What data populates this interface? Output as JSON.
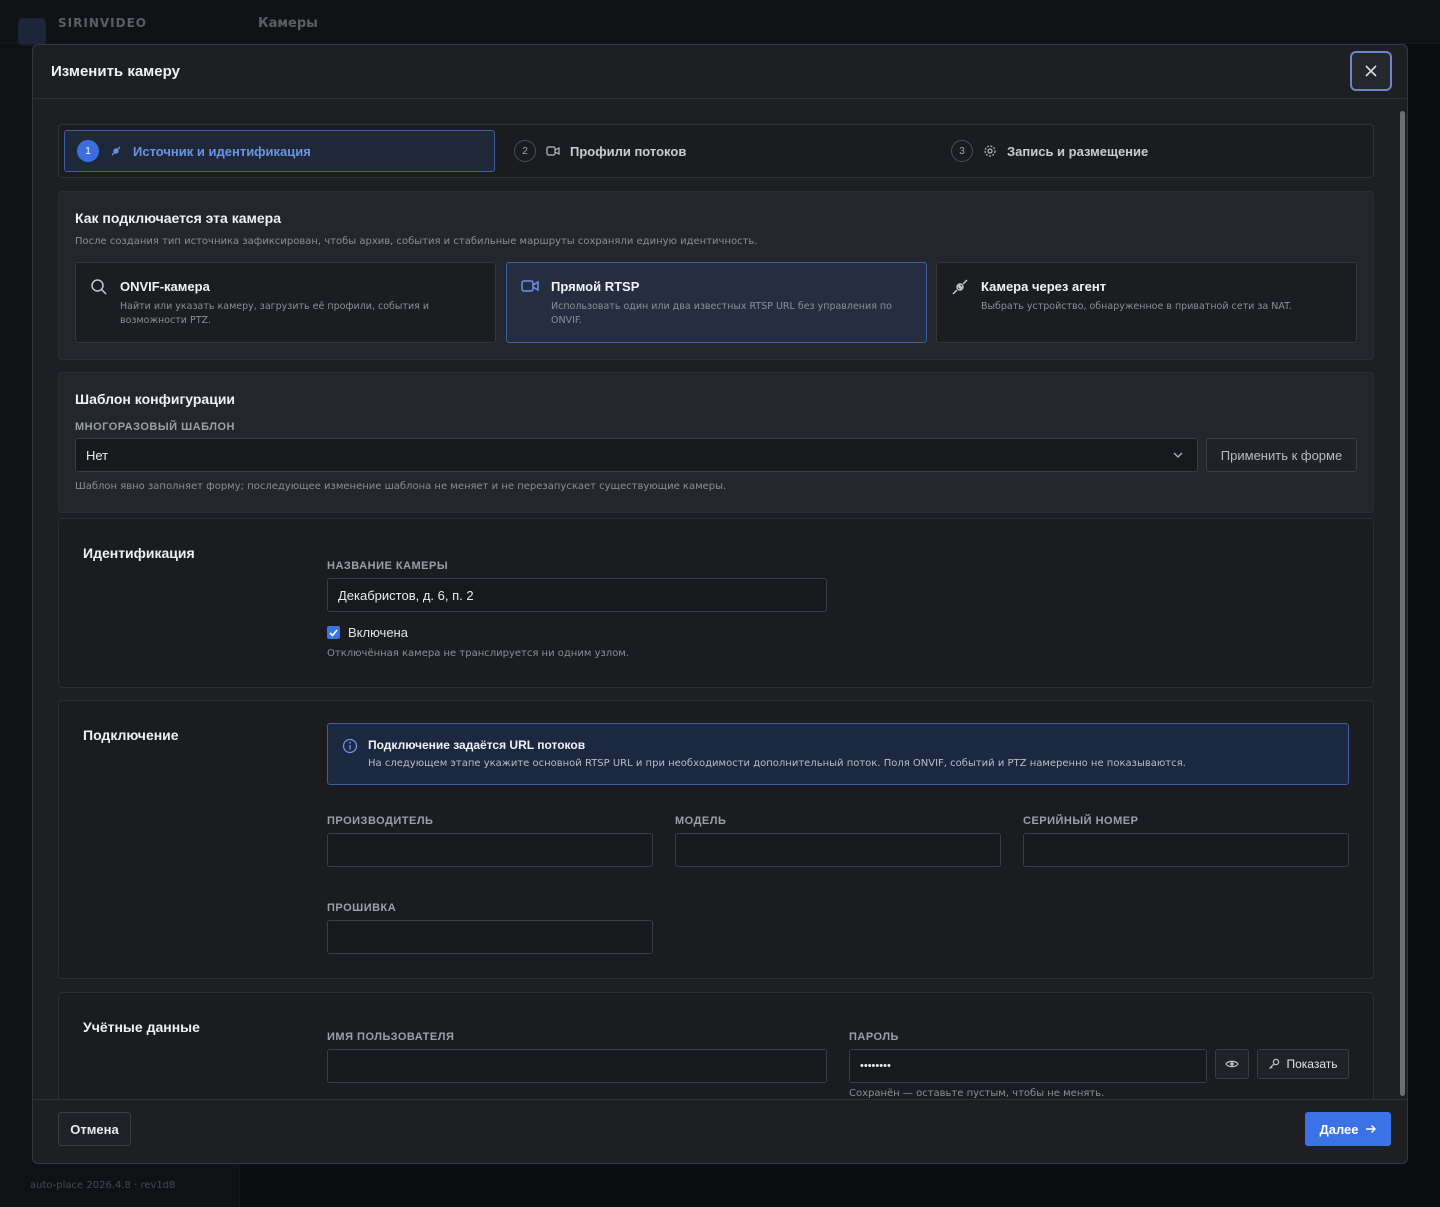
{
  "background": {
    "brand": "SIRINVIDEO",
    "page_title": "Камеры",
    "footer": "auto-place 2026.4.8 · rev1d8"
  },
  "modal": {
    "title": "Изменить камеру"
  },
  "stepper": {
    "steps": [
      {
        "num": "1",
        "label": "Источник и идентификация"
      },
      {
        "num": "2",
        "label": "Профили потоков"
      },
      {
        "num": "3",
        "label": "Запись и размещение"
      }
    ]
  },
  "source": {
    "title": "Как подключается эта камера",
    "hint": "После создания тип источника зафиксирован, чтобы архив, события и стабильные маршруты сохраняли единую идентичность.",
    "options": [
      {
        "title": "ONVIF-камера",
        "desc": "Найти или указать камеру, загрузить её профили, события и возможности PTZ.",
        "icon": "search-icon"
      },
      {
        "title": "Прямой RTSP",
        "desc": "Использовать один или два известных RTSP URL без управления по ONVIF.",
        "icon": "video-camera-icon"
      },
      {
        "title": "Камера через агент",
        "desc": "Выбрать устройство, обнаруженное в приватной сети за NAT.",
        "icon": "plug-icon"
      }
    ]
  },
  "template": {
    "title": "Шаблон конфигурации",
    "label": "Многоразовый шаблон",
    "value": "Нет",
    "apply": "Применить к форме",
    "hint": "Шаблон явно заполняет форму; последующее изменение шаблона не меняет и не перезапускает существующие камеры."
  },
  "identity": {
    "title": "Идентификация",
    "name_label": "Название камеры",
    "name_value": "Декабристов, д. 6, п. 2",
    "enabled_label": "Включена",
    "enabled": true,
    "enabled_hint": "Отключённая камера не транслируется ни одним узлом."
  },
  "connection": {
    "title": "Подключение",
    "alert_title": "Подключение задаётся URL потоков",
    "alert_text": "На следующем этапе укажите основной RTSP URL и при необходимости дополнительный поток. Поля ONVIF, событий и PTZ намеренно не показываются.",
    "manufacturer_label": "Производитель",
    "model_label": "Модель",
    "serial_label": "Серийный номер",
    "firmware_label": "Прошивка"
  },
  "credentials": {
    "title": "Учётные данные",
    "username_label": "Имя пользователя",
    "password_label": "Пароль",
    "password_value": "••••••••",
    "show": "Показать",
    "password_hint": "Сохранён — оставьте пустым, чтобы не менять."
  },
  "footer": {
    "cancel": "Отмена",
    "next": "Далее"
  },
  "colors": {
    "accent": "#3b72e6",
    "active_border": "#3d5f9f"
  }
}
